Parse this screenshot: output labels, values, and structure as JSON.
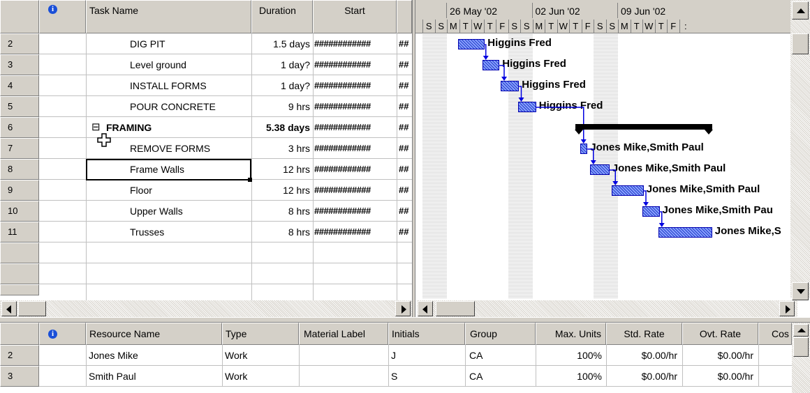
{
  "top_table": {
    "headers": {
      "info": "i",
      "task_name": "Task Name",
      "duration": "Duration",
      "start": "Start"
    },
    "rows": [
      {
        "id": "2",
        "name": "DIG PIT",
        "duration": "1.5 days",
        "start": "############",
        "extra": "##"
      },
      {
        "id": "3",
        "name": "Level ground",
        "duration": "1 day?",
        "start": "############",
        "extra": "##"
      },
      {
        "id": "4",
        "name": "INSTALL FORMS",
        "duration": "1 day?",
        "start": "############",
        "extra": "##"
      },
      {
        "id": "5",
        "name": "POUR CONCRETE",
        "duration": "9 hrs",
        "start": "############",
        "extra": "##"
      },
      {
        "id": "6",
        "name": "FRAMING",
        "duration": "5.38 days",
        "start": "############",
        "extra": "##",
        "summary": true
      },
      {
        "id": "7",
        "name": "REMOVE FORMS",
        "duration": "3 hrs",
        "start": "############",
        "extra": "##"
      },
      {
        "id": "8",
        "name": "Frame Walls",
        "duration": "12 hrs",
        "start": "############",
        "extra": "##"
      },
      {
        "id": "9",
        "name": "Floor",
        "duration": "12 hrs",
        "start": "############",
        "extra": "##"
      },
      {
        "id": "10",
        "name": "Upper Walls",
        "duration": "8 hrs",
        "start": "############",
        "extra": "##"
      },
      {
        "id": "11",
        "name": "Trusses",
        "duration": "8 hrs",
        "start": "############",
        "extra": "##"
      }
    ],
    "collapse_symbol": "⊟"
  },
  "gantt": {
    "weeks": [
      "26 May '02",
      "02 Jun '02",
      "09 Jun '02"
    ],
    "days": [
      "S",
      "S",
      "M",
      "T",
      "W",
      "T",
      "F",
      "S",
      "S",
      "M",
      "T",
      "W",
      "T",
      "F",
      "S",
      "S",
      "M",
      "T",
      "W",
      "T",
      "F",
      ":"
    ],
    "resources": [
      "Higgins Fred",
      "Higgins Fred",
      "Higgins Fred",
      "Higgins Fred",
      "",
      "Jones Mike,Smith Paul",
      "Jones Mike,Smith Paul",
      "Jones Mike,Smith Paul",
      "Jones Mike,Smith Pau",
      "Jones Mike,S"
    ]
  },
  "bottom_table": {
    "headers": {
      "info": "i",
      "resource_name": "Resource Name",
      "type": "Type",
      "material_label": "Material Label",
      "initials": "Initials",
      "group": "Group",
      "max_units": "Max. Units",
      "std_rate": "Std. Rate",
      "ovt_rate": "Ovt. Rate",
      "cost": "Cos"
    },
    "rows": [
      {
        "id": "2",
        "name": "Jones Mike",
        "type": "Work",
        "material": "",
        "initials": "J",
        "group": "CA",
        "max_units": "100%",
        "std_rate": "$0.00/hr",
        "ovt_rate": "$0.00/hr"
      },
      {
        "id": "3",
        "name": "Smith Paul",
        "type": "Work",
        "material": "",
        "initials": "S",
        "group": "CA",
        "max_units": "100%",
        "std_rate": "$0.00/hr",
        "ovt_rate": "$0.00/hr"
      }
    ]
  },
  "colors": {
    "bar": "#4a6cf0",
    "summary_bar": "#000000",
    "link": "#0000e0",
    "header_bg": "#d4d0c8"
  }
}
